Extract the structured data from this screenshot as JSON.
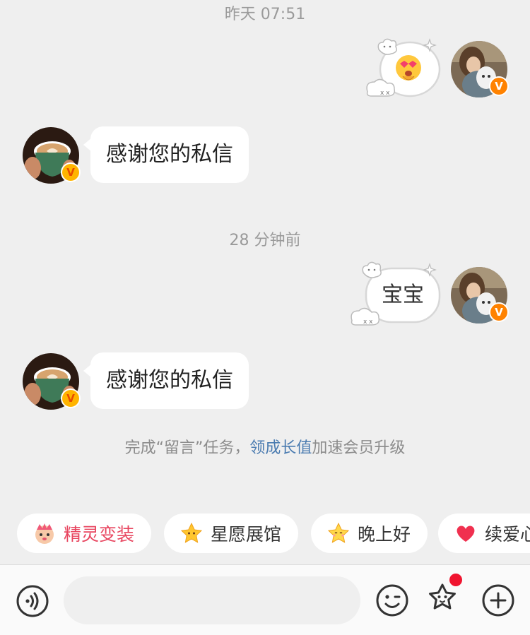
{
  "timestamps": {
    "first": "昨天 07:51",
    "second": "28 分钟前"
  },
  "messages": {
    "received_1": "感谢您的私信",
    "sent_2": "宝宝",
    "received_2": "感谢您的私信"
  },
  "verified_badge": "V",
  "system_tip": {
    "prefix": "完成“留言”任务，",
    "link": "领成长值",
    "suffix": "加速会员升级"
  },
  "quick_chips": [
    {
      "label": "精灵变装",
      "icon": "sprite-icon",
      "color": "#e8455f"
    },
    {
      "label": "星愿展馆",
      "icon": "star-icon",
      "color": "#333333"
    },
    {
      "label": "晚上好",
      "icon": "star-face-icon",
      "color": "#333333"
    },
    {
      "label": "续爱心",
      "icon": "heart-icon",
      "color": "#333333"
    }
  ],
  "input": {
    "placeholder": "",
    "value": ""
  },
  "colors": {
    "accent_orange": "#ff8200",
    "link_blue": "#4a7bb0",
    "notification_dot": "#f0142f",
    "background": "#efefef"
  }
}
